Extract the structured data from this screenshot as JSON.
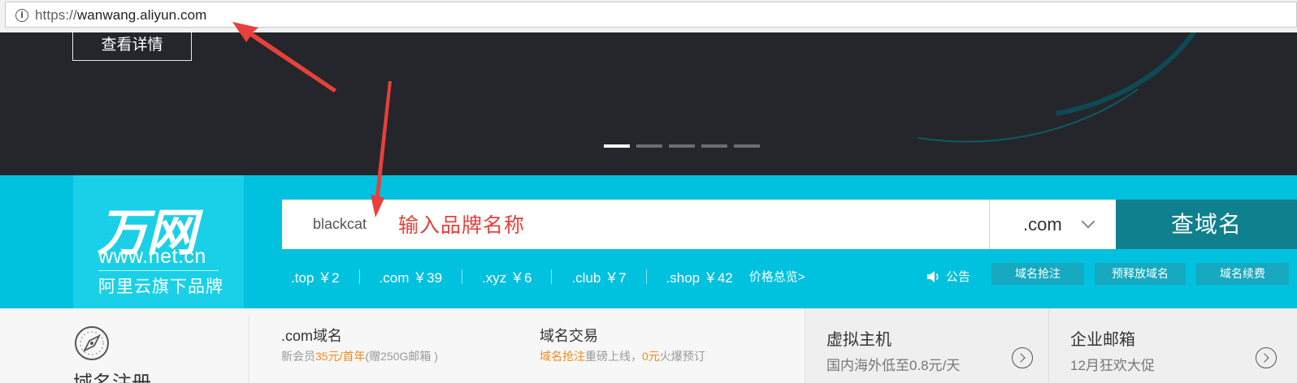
{
  "browser": {
    "url_scheme": "https://",
    "url_host": "wanwang.aliyun.com",
    "info_icon": "info-icon"
  },
  "banner": {
    "detail_button": "查看详情",
    "slides_total": 5,
    "slides_active": 1
  },
  "brand": {
    "logo_main": "万网",
    "logo_url": "www.net.cn",
    "logo_sub": "阿里云旗下品牌"
  },
  "search": {
    "value": "blackcat",
    "tld_selected": ".com",
    "button": "查域名"
  },
  "annotation": {
    "text": "输入品牌名称",
    "color": "#e8403b"
  },
  "prices": [
    {
      "label": ".top ￥2"
    },
    {
      "label": ".com ￥39"
    },
    {
      "label": ".xyz ￥6"
    },
    {
      "label": ".club ￥7"
    },
    {
      "label": ".shop ￥42"
    }
  ],
  "price_overview": "价格总览>",
  "notice": {
    "label": "公告",
    "icon": "speaker-icon"
  },
  "quick_links": [
    "域名抢注",
    "预释放域名",
    "域名续费"
  ],
  "lower": {
    "reg_title": "域名注册",
    "reg_icon": "compass-icon",
    "com": {
      "title": ".com域名",
      "desc_pre": "新会员",
      "desc_hl": "35元/首年",
      "desc_post": "(赠250G邮箱 )"
    },
    "trade": {
      "title": "域名交易",
      "desc_hl": "域名抢注",
      "desc_mid": "重磅上线，",
      "desc_hl2": "0元",
      "desc_post": "火爆预订"
    },
    "hosting": {
      "title": "虚拟主机",
      "desc": "国内海外低至0.8元/天"
    },
    "mail": {
      "title": "企业邮箱",
      "desc": "12月狂欢大促"
    }
  },
  "colors": {
    "strip": "#00c1de",
    "button": "#0f808e",
    "banner": "#24262b",
    "highlight": "#f08a1d"
  }
}
